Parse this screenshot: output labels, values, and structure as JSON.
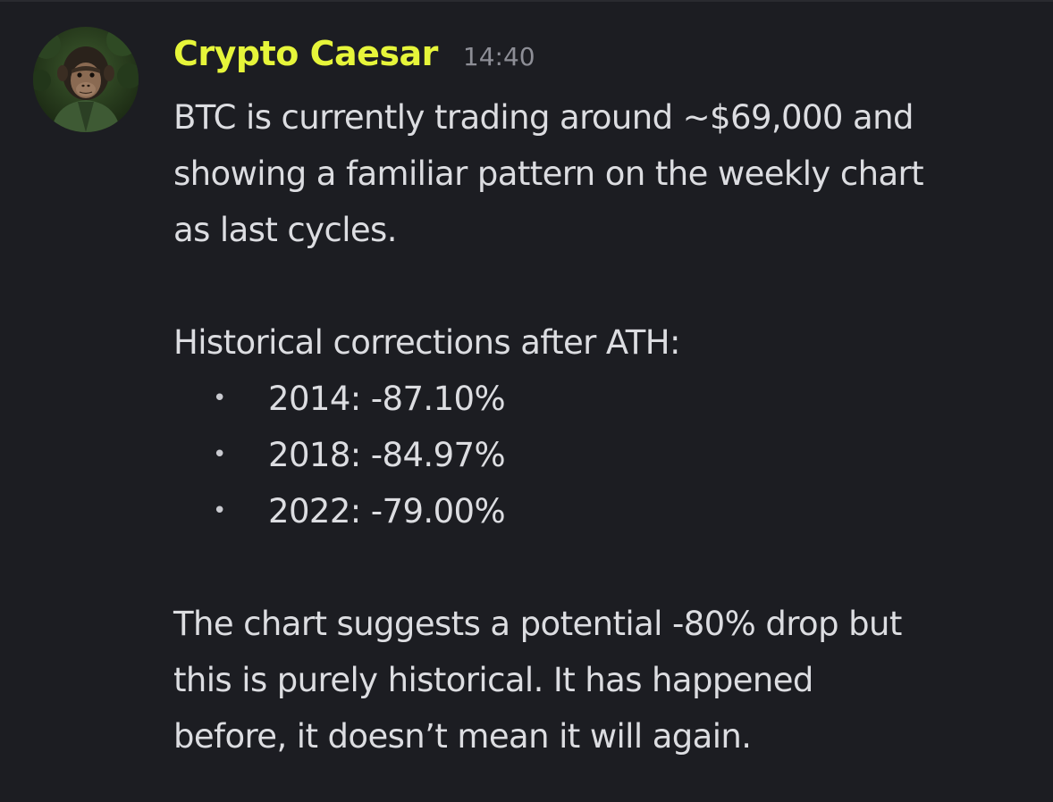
{
  "message": {
    "author": "Crypto Caesar",
    "timestamp": "14:40",
    "avatar_icon": "chimp-avatar-icon",
    "paragraph_1": [
      "BTC is currently trading around ~$69,000 and",
      "showing a familiar pattern on the weekly chart",
      "as last cycles."
    ],
    "list_heading": "Historical corrections after ATH:",
    "bullet_char": "•",
    "corrections": [
      "2014: -87.10%",
      "2018: -84.97%",
      "2022: -79.00%"
    ],
    "paragraph_2": [
      "The chart suggests a potential -80% drop but",
      "this is purely historical. It has happened",
      "before, it doesn’t mean it will again."
    ]
  },
  "colors": {
    "background": "#1c1d22",
    "username": "#e6f53a",
    "text": "#dcdde1",
    "timestamp": "#8d8e96"
  }
}
